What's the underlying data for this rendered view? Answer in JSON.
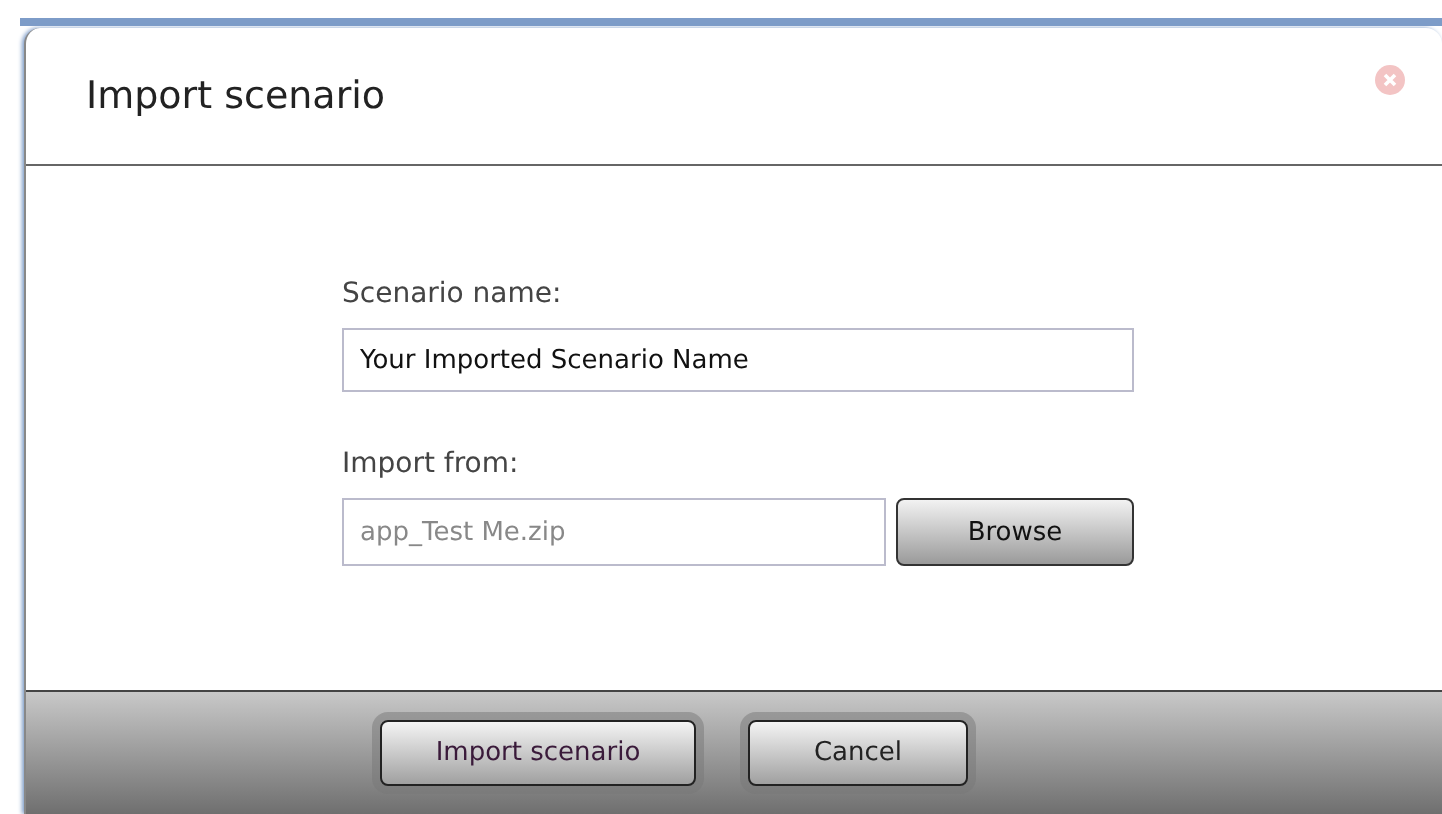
{
  "dialog": {
    "title": "Import scenario",
    "fields": [
      {
        "label": "Scenario name:",
        "value": "Your Imported Scenario Name",
        "kind": "text"
      },
      {
        "label": "Import from:",
        "value": "app_Test Me.zip",
        "kind": "file",
        "button": "Browse"
      }
    ],
    "buttons": [
      "Import scenario",
      "Cancel"
    ]
  }
}
